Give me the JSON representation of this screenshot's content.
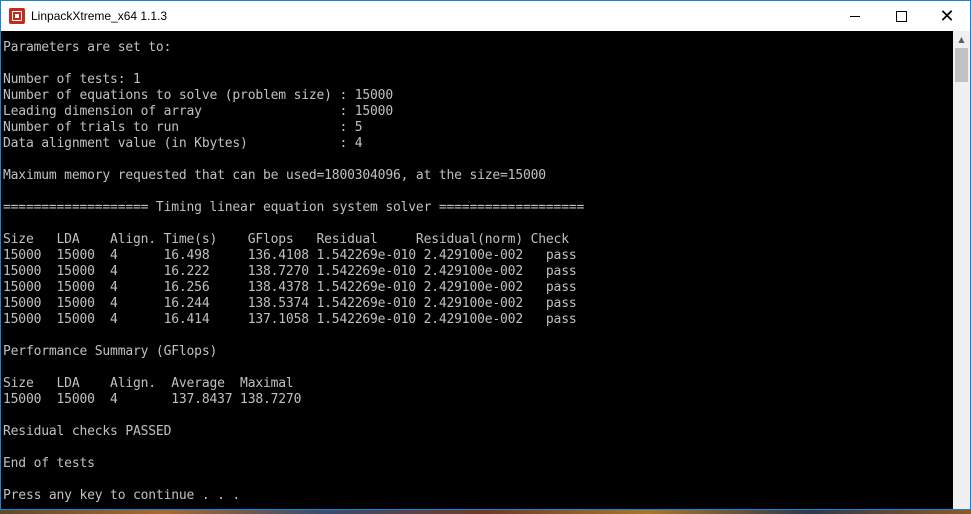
{
  "window": {
    "title": "LinpackXtreme_x64 1.1.3",
    "controls": {
      "minimize": "minimize",
      "maximize": "maximize",
      "close": "✕"
    }
  },
  "console": {
    "lines": [
      "Parameters are set to:",
      "",
      "Number of tests: 1",
      "Number of equations to solve (problem size) : 15000",
      "Leading dimension of array                  : 15000",
      "Number of trials to run                     : 5",
      "Data alignment value (in Kbytes)            : 4",
      "",
      "Maximum memory requested that can be used=1800304096, at the size=15000",
      "",
      "=================== Timing linear equation system solver ===================",
      "",
      "Size   LDA    Align. Time(s)    GFlops   Residual     Residual(norm) Check",
      "15000  15000  4      16.498     136.4108 1.542269e-010 2.429100e-002   pass",
      "15000  15000  4      16.222     138.7270 1.542269e-010 2.429100e-002   pass",
      "15000  15000  4      16.256     138.4378 1.542269e-010 2.429100e-002   pass",
      "15000  15000  4      16.244     138.5374 1.542269e-010 2.429100e-002   pass",
      "15000  15000  4      16.414     137.1058 1.542269e-010 2.429100e-002   pass",
      "",
      "Performance Summary (GFlops)",
      "",
      "Size   LDA    Align.  Average  Maximal",
      "15000  15000  4       137.8437 138.7270",
      "",
      "Residual checks PASSED",
      "",
      "End of tests",
      "",
      "Press any key to continue . . ."
    ]
  },
  "colors": {
    "console_bg": "#000000",
    "console_text": "#c0c0c0",
    "window_border": "#1883d7"
  }
}
